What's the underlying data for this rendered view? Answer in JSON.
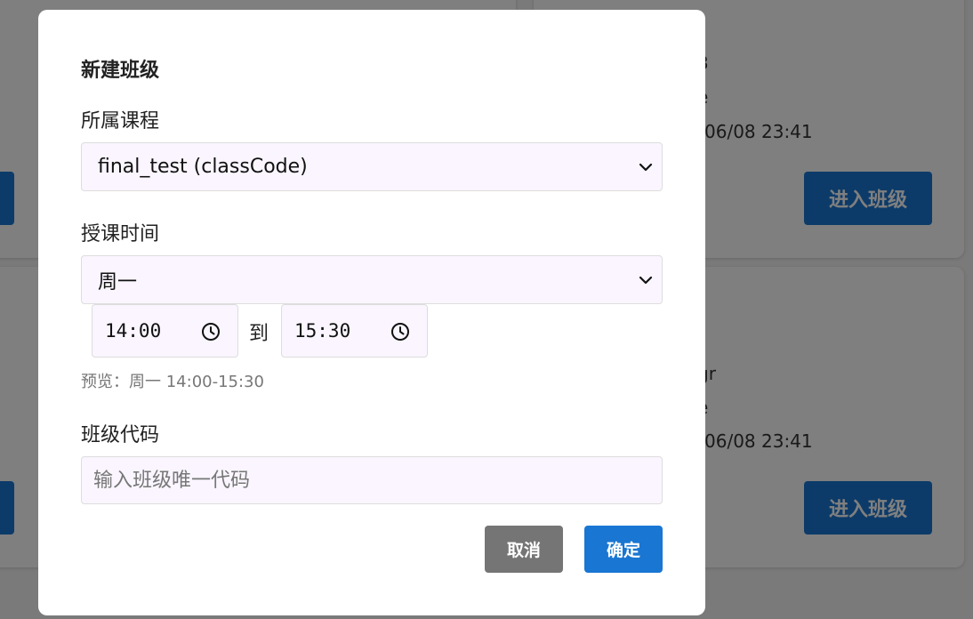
{
  "background": {
    "cards": [
      {
        "partial_lines": [
          "3",
          "e",
          "06/08 23:41"
        ],
        "enter_label": "进入班级"
      },
      {
        "partial_lines": [
          "gr",
          "e",
          "06/08 23:41"
        ],
        "enter_label": "进入班级"
      }
    ]
  },
  "dialog": {
    "title": "新建班级",
    "course": {
      "label": "所属课程",
      "selected": "final_test (classCode)"
    },
    "schedule": {
      "label": "授课时间",
      "day_selected": "周一",
      "start_time": "14:00",
      "to_label": "到",
      "end_time": "15:30",
      "preview": "预览：周一 14:00-15:30"
    },
    "class_code": {
      "label": "班级代码",
      "value": "",
      "placeholder": "输入班级唯一代码"
    },
    "buttons": {
      "cancel": "取消",
      "confirm": "确定"
    }
  },
  "colors": {
    "primary": "#1976d2",
    "cancel": "#757575",
    "input_bg": "#faf5fe"
  }
}
